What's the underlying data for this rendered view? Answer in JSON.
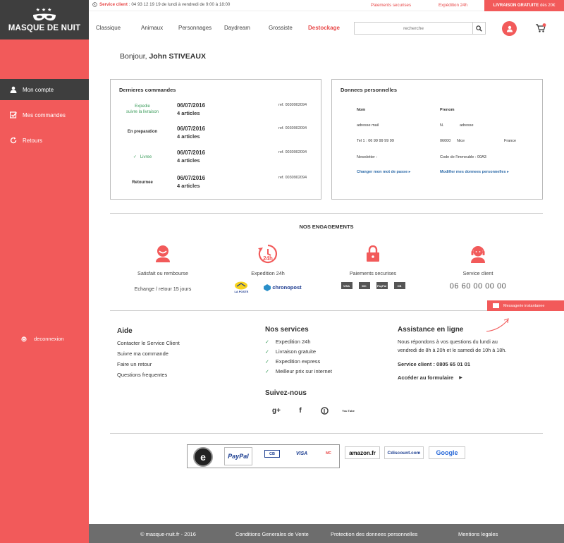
{
  "brand": {
    "stars": "★★★",
    "name": "MASQUE DE NUIT"
  },
  "sidebar": {
    "items": [
      {
        "label": "Mon compte",
        "icon": "user-icon"
      },
      {
        "label": "Mes commandes",
        "icon": "checkbox-icon"
      },
      {
        "label": "Retours",
        "icon": "refresh-icon"
      }
    ],
    "logout": "deconnexion"
  },
  "topbar": {
    "service_label": "Service client",
    "service_hours": ": 04 93 12 19 19 de lundi à vendredi de 9:00 à 18:00",
    "payments": "Paiements securises",
    "shipping": "Expédition 24h",
    "free_delivery": "LIVRAISON GRATUITE",
    "free_delivery_threshold": "dès 20€"
  },
  "nav": {
    "links": [
      "Classique",
      "Animaux",
      "Personnages",
      "Daydream",
      "Grossiste",
      "Destockage"
    ],
    "search_placeholder": "recherche",
    "cart_count": "0"
  },
  "greeting": {
    "prefix": "Bonjour,",
    "name": "John STIVEAUX"
  },
  "orders": {
    "title": "Dernieres commandes",
    "rows": [
      {
        "status": "Expedie",
        "status2": "suivre la livraison",
        "date": "06/07/2016",
        "count": "4 articles",
        "ref": "ref. 0030902094"
      },
      {
        "status": "En preparation",
        "status2": "",
        "date": "06/07/2016",
        "count": "4 articles",
        "ref": "ref. 0030902094"
      },
      {
        "status": "Livree",
        "status2": "",
        "date": "06/07/2016",
        "count": "4 articles",
        "ref": "ref. 0030902094"
      },
      {
        "status": "Retournee",
        "status2": "",
        "date": "06/07/2016",
        "count": "4 articles",
        "ref": "ref. 0030902094"
      }
    ]
  },
  "personal": {
    "title": "Donnees personnelles",
    "nom": "Nom",
    "prenom": "Prenom",
    "email": "adresse mail",
    "number": "N.",
    "address": "adresse",
    "tel": "Tel 1 : 06 99 99 99 99",
    "postcode": "06000",
    "city": "Nice",
    "country": "France",
    "newsletter": "Newsletter :",
    "building_code": "Code de l'immeuble : 00A3",
    "change_password": "Changer mon mot de passe",
    "edit_data": "Modifier mes donnees personnelles"
  },
  "engagements": {
    "title": "NOS ENGAGEMENTS",
    "items": [
      {
        "title": "Satisfait ou rembourse",
        "sub": "Echange / retour 15 jours"
      },
      {
        "title": "Expedition 24h",
        "icon_text": "24h",
        "logo1": "LA POSTE",
        "logo2": "chronopost"
      },
      {
        "title": "Paiements securises",
        "cards": [
          "VISA",
          "MC",
          "PayPal",
          "CB"
        ]
      },
      {
        "title": "Service client",
        "phone": "06 60 00 00 00"
      }
    ]
  },
  "chat": {
    "label": "Messagerie instantanee"
  },
  "footer": {
    "aide": {
      "title": "Aide",
      "links": [
        "Contacter le Service Client",
        "Suivre ma commande",
        "Faire un retour",
        "Questions frequentes"
      ]
    },
    "services": {
      "title": "Nos services",
      "items": [
        "Expedition 24h",
        "Livraison gratuite",
        "Expedition express",
        "Meilleur prix sur internet"
      ]
    },
    "follow": {
      "title": "Suivez-nous",
      "networks": [
        "g+",
        "f",
        "p",
        "You Tube"
      ]
    },
    "assistance": {
      "title": "Assistance en ligne",
      "text": "Nous répondons à vos questions du lundi au vendredi de 8h à 20h et le samedi de 10h à 18h.",
      "phone": "Service client : 0805 65 01 01",
      "form": "Accéder au formulaire"
    }
  },
  "partners": {
    "items": [
      "e",
      "PayPal",
      "CB",
      "VISA",
      "MC",
      "amazon.fr",
      "Cdiscount.com",
      "Google"
    ]
  },
  "bottombar": {
    "copyright": "©   masque-nuit.fr - 2016",
    "cgv": "Conditions Generales de Vente",
    "privacy": "Protection des donnees personnelles",
    "legal": "Mentions legales"
  },
  "colors": {
    "accent": "#f25a5a",
    "dark": "#3e3e3e",
    "green": "#3a9b5a",
    "link": "#2c6aa8"
  }
}
